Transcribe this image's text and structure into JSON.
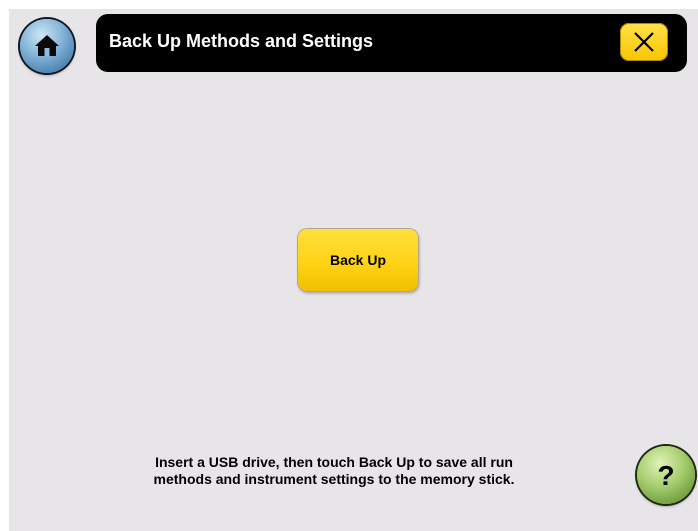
{
  "header": {
    "title": "Back Up Methods and Settings",
    "home_icon": "home-icon",
    "close_icon": "close-x-icon"
  },
  "main": {
    "backup_button_label": "Back Up"
  },
  "footer": {
    "instruction_line1": "Insert a USB drive, then touch Back Up to save all run",
    "instruction_line2": "methods and instrument settings to the memory stick.",
    "help_label": "?"
  },
  "colors": {
    "background": "#e8e5e8",
    "title_bar": "#000000",
    "accent_yellow": "#ffd316",
    "home_blue": "#7fb1d6",
    "help_green": "#a4cc6b"
  }
}
